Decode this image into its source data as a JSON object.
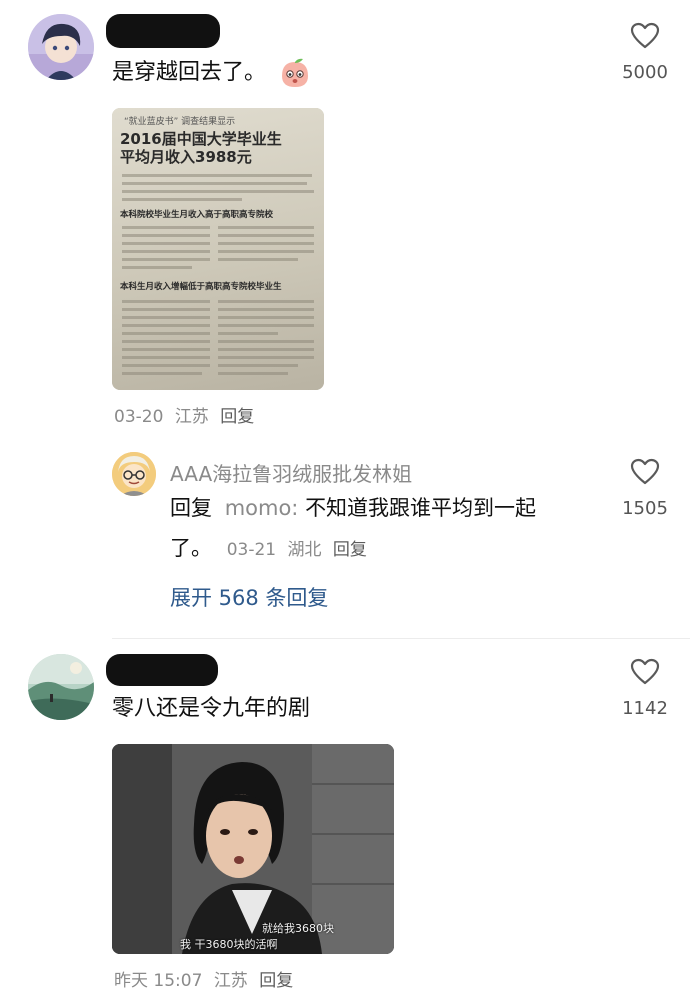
{
  "comments": [
    {
      "text": "是穿越回去了。",
      "emoji_icon": "peach-face-emoji",
      "likes": "5000",
      "meta": {
        "date": "03-20",
        "location": "江苏",
        "reply_label": "回复"
      },
      "image": {
        "kind": "newspaper-clipping",
        "top_caption": "“就业蓝皮书” 调查结果显示",
        "headline_line1": "2016届中国大学毕业生",
        "headline_line2": "平均月收入3988元",
        "subhead1": "本科院校毕业生月收入高于高职高专院校",
        "subhead2": "本科生月收入增幅低于高职高专院校毕业生"
      },
      "replies": [
        {
          "name": "AAA海拉鲁羽绒服批发林姐",
          "prefix": "回复",
          "mention": "momo",
          "text_line1": "不知道我跟谁平均到一起",
          "text_line2": "了。",
          "likes": "1505",
          "meta": {
            "date": "03-21",
            "location": "湖北",
            "reply_label": "回复"
          }
        }
      ],
      "expand_label": "展开 568 条回复"
    },
    {
      "text": "零八还是令九年的剧",
      "likes": "1142",
      "meta": {
        "date": "昨天 15:07",
        "location": "江苏",
        "reply_label": "回复"
      },
      "image": {
        "kind": "tv-drama-still",
        "subtitle_line1": "就给我3680块",
        "subtitle_line2": "我         干3680块的活啊"
      }
    }
  ]
}
